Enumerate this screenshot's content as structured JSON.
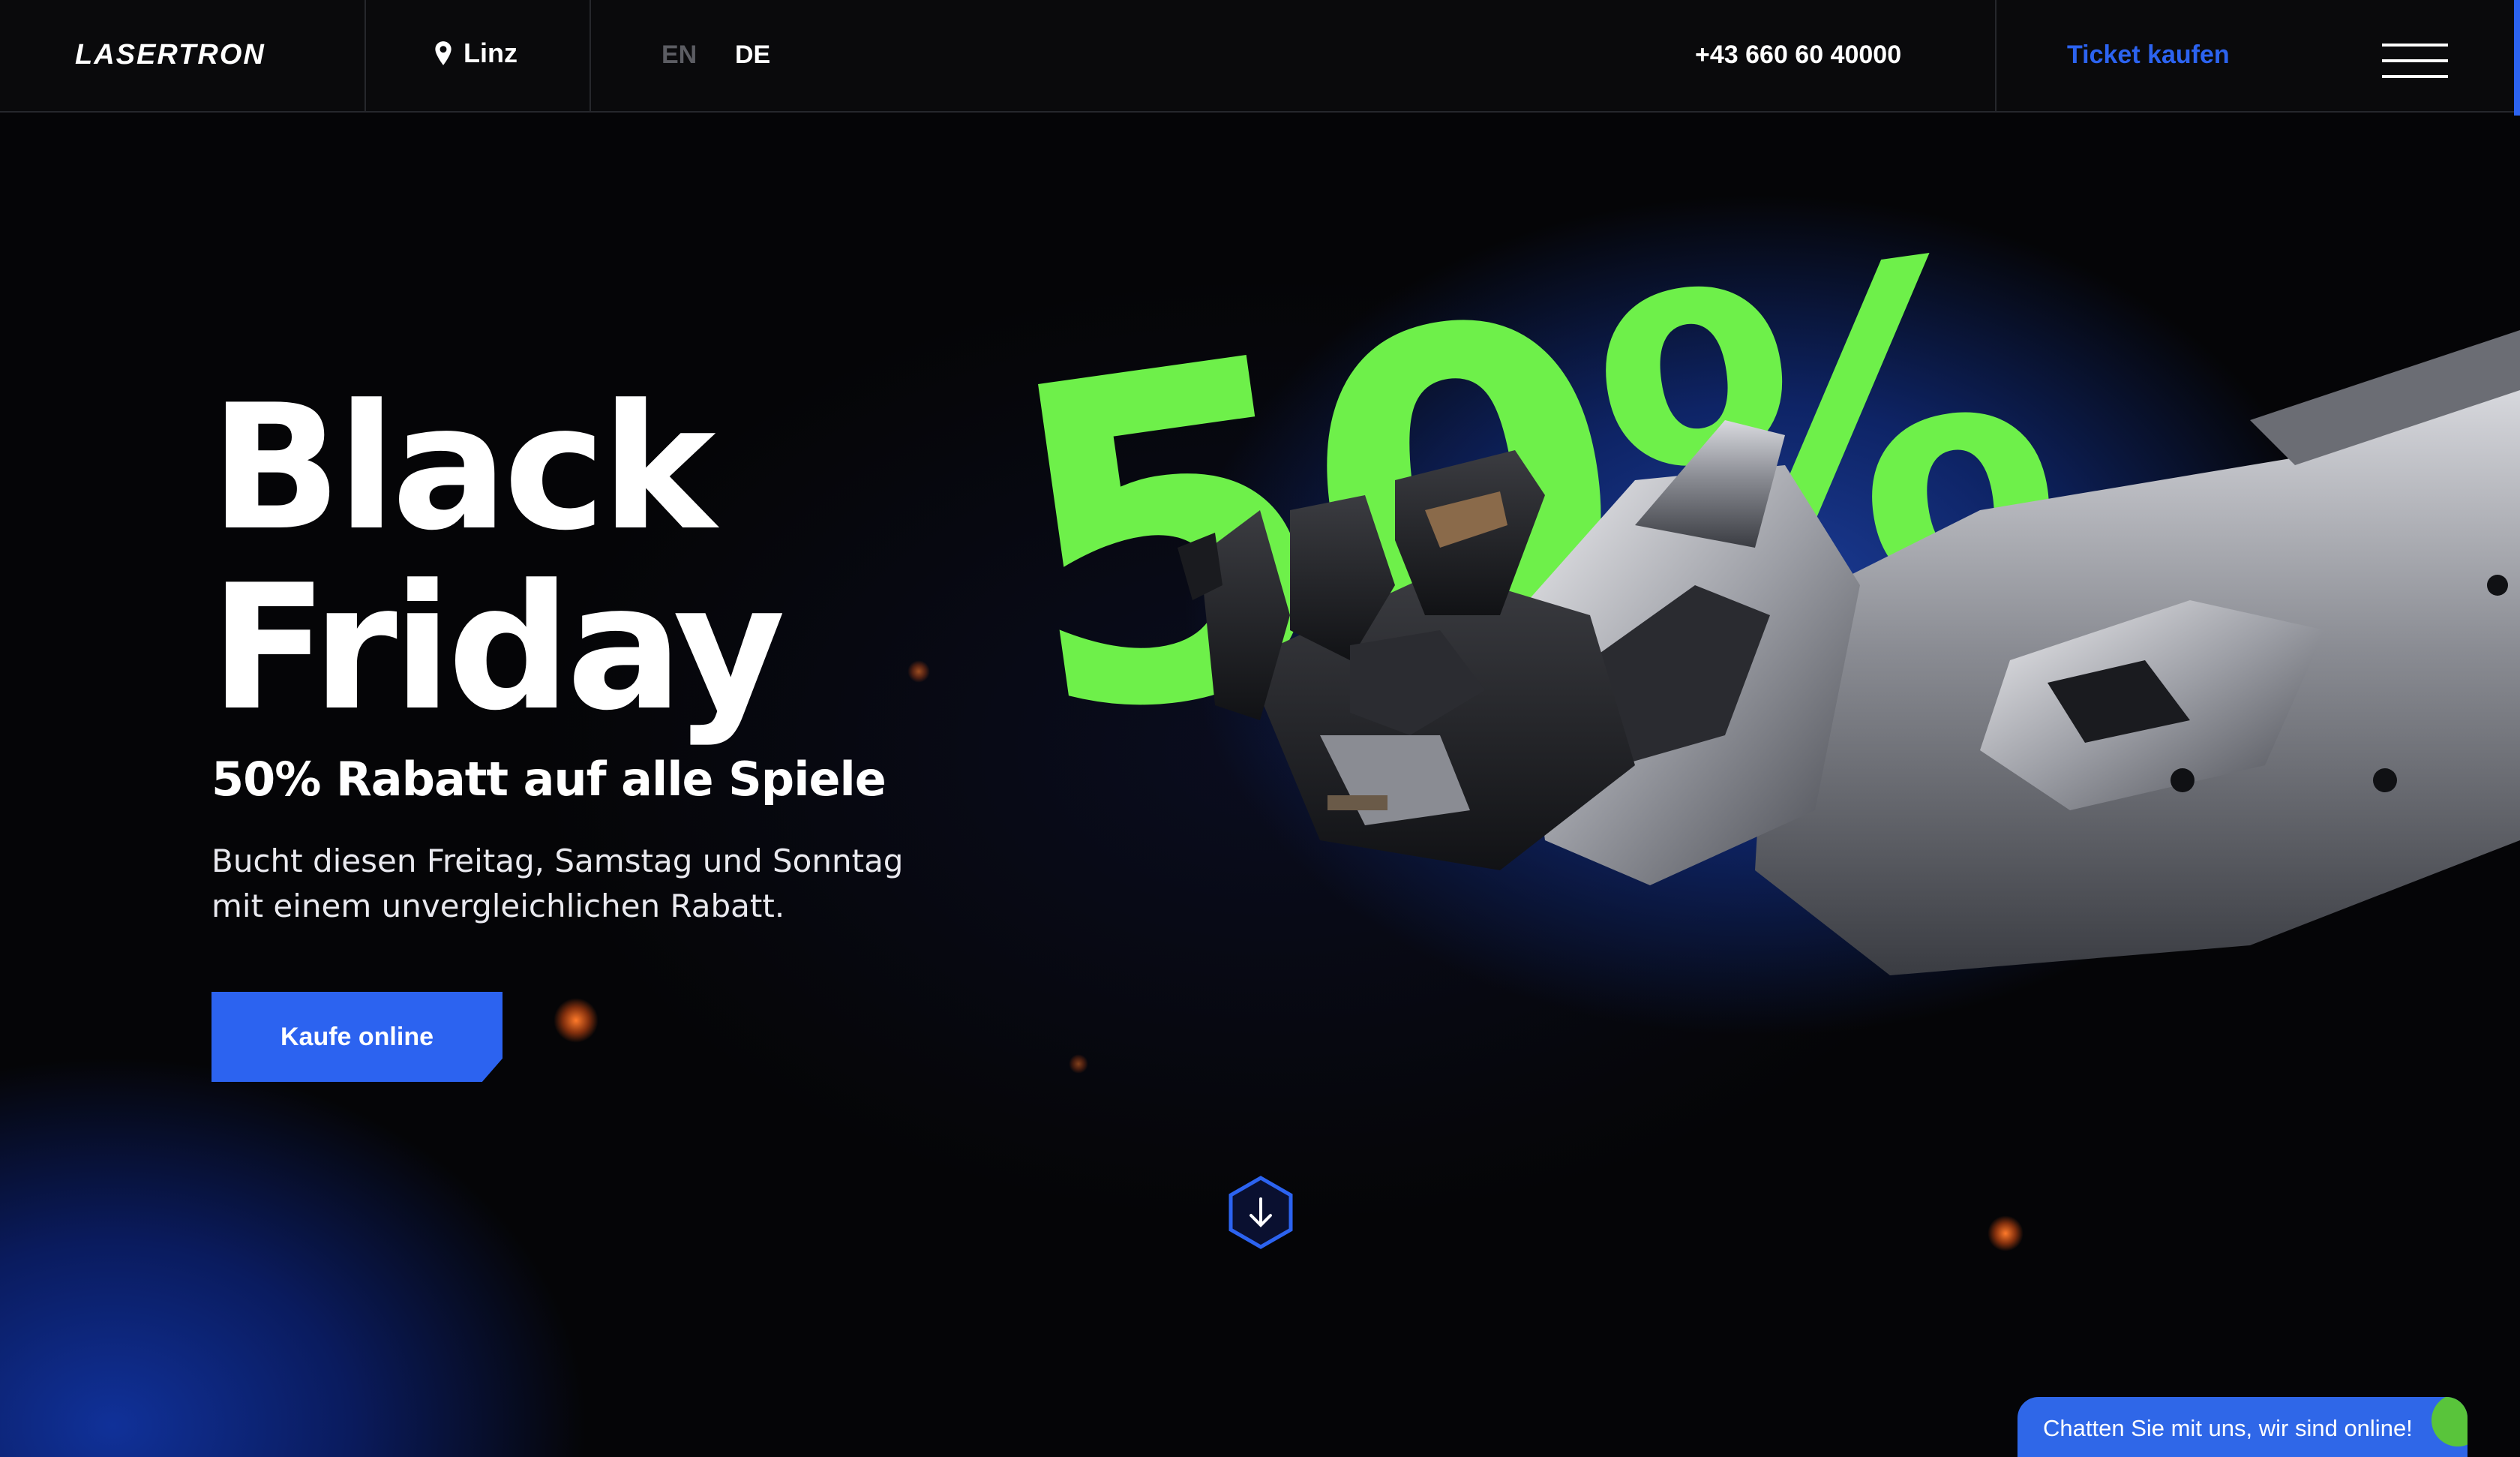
{
  "header": {
    "logo": "LASERTRON",
    "location": "Linz",
    "languages": [
      "EN",
      "DE"
    ],
    "active_language": "DE",
    "phone": "+43 660 60 40000",
    "ticket_link": "Ticket kaufen",
    "menu_icon": "hamburger-menu-icon"
  },
  "hero": {
    "title_line1": "Black",
    "title_line2": "Friday",
    "subtitle": "50% Rabatt auf alle Spiele",
    "description": "Bucht diesen Freitag, Samstag und Sonntag mit einem unvergleichlichen Rabatt.",
    "cta_label": "Kaufe online",
    "promo_graphic_text": "50%",
    "scroll_icon": "arrow-down-icon"
  },
  "chat_widget": {
    "label": "Chatten Sie mit uns, wir sind online!"
  },
  "colors": {
    "accent_blue": "#2c63f0",
    "promo_green": "#6ef04a",
    "background": "#050507"
  }
}
